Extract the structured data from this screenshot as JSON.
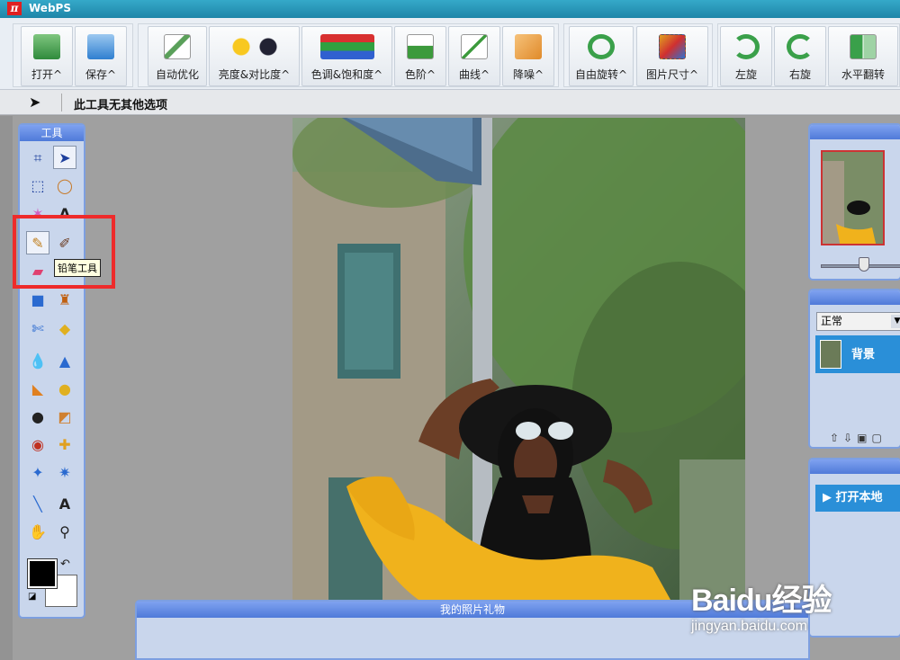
{
  "app": {
    "title": "WebPS",
    "logo_glyph": "π"
  },
  "toolbar": {
    "buttons": [
      {
        "id": "open",
        "label": "打开^",
        "icon": "open-folder-icon",
        "color": "#3fa34d"
      },
      {
        "id": "save",
        "label": "保存^",
        "icon": "save-icon",
        "color": "#2f7fd0"
      },
      {
        "id": "auto",
        "label": "自动优化",
        "icon": "auto-enhance-icon",
        "color": "#5aa05a"
      },
      {
        "id": "brightness",
        "label": "亮度&对比度^",
        "icon": "brightness-contrast-icon",
        "color": "#f2b21c"
      },
      {
        "id": "hue",
        "label": "色调&饱和度^",
        "icon": "hue-saturation-icon",
        "color": "#d04040"
      },
      {
        "id": "levels",
        "label": "色阶^",
        "icon": "levels-icon",
        "color": "#3c9a3c"
      },
      {
        "id": "curves",
        "label": "曲线^",
        "icon": "curves-icon",
        "color": "#3c9a3c"
      },
      {
        "id": "denoise",
        "label": "降噪^",
        "icon": "denoise-icon",
        "color": "#e08a2a"
      },
      {
        "id": "free-rotate",
        "label": "自由旋转^",
        "icon": "free-rotate-icon",
        "color": "#3aa04a"
      },
      {
        "id": "image-size",
        "label": "图片尺寸^",
        "icon": "image-size-icon",
        "color": "#e0a020"
      },
      {
        "id": "rotate-left",
        "label": "左旋",
        "icon": "rotate-left-icon",
        "color": "#3aa04a"
      },
      {
        "id": "rotate-right",
        "label": "右旋",
        "icon": "rotate-right-icon",
        "color": "#3aa04a"
      },
      {
        "id": "flip-h",
        "label": "水平翻转",
        "icon": "flip-horizontal-icon",
        "color": "#3aa04a"
      }
    ]
  },
  "options_bar": {
    "text": "此工具无其他选项"
  },
  "toolbox": {
    "title": "工具",
    "tooltip": "铅笔工具",
    "foreground_color": "#000000",
    "background_color": "#ffffff"
  },
  "layers_panel": {
    "blend_mode": "正常",
    "layer_name": "背景"
  },
  "history_panel": {
    "item": "打开本地"
  },
  "bottom_panel": {
    "title": "我的照片礼物"
  },
  "watermark": {
    "brand": "Baidu经验",
    "url": "jingyan.baidu.com"
  }
}
